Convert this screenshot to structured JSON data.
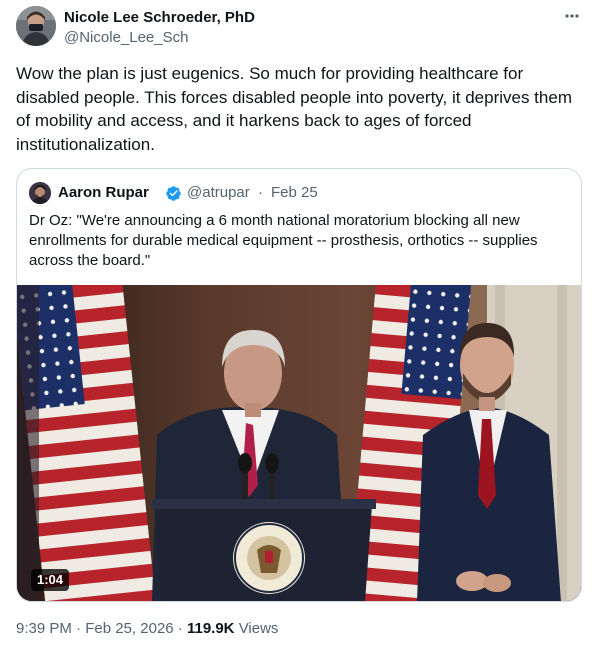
{
  "author": {
    "name": "Nicole Lee Schroeder, PhD",
    "handle": "@Nicole_Lee_Sch",
    "avatar_icon": "avatar-photo-icon"
  },
  "tweet": {
    "text": "Wow the plan is just eugenics. So much for providing healthcare for disabled people. This forces disabled people into poverty, it deprives them of mobility and access, and it harkens back to ages of forced institutionalization."
  },
  "quoted": {
    "name": "Aaron Rupar",
    "handle": "@atrupar",
    "separator": "·",
    "date": "Feb 25",
    "text": "Dr Oz: \"We're announcing a 6 month national moratorium blocking all new enrollments for durable medical equipment -- prosthesis, orthotics -- supplies across the board.\"",
    "verified_color": "#1d9bf0",
    "video": {
      "duration": "1:04",
      "seal_text": "SEAL OF THE VICE PRESIDENT OF THE UNITED STATES"
    }
  },
  "footer": {
    "time": "9:39 PM",
    "sep1": "·",
    "date": "Feb 25, 2026",
    "sep2": "·",
    "views_count": "119.9K",
    "views_label": "Views"
  },
  "colors": {
    "text_primary": "#0f1419",
    "text_secondary": "#536471",
    "border": "#cfd9de"
  }
}
